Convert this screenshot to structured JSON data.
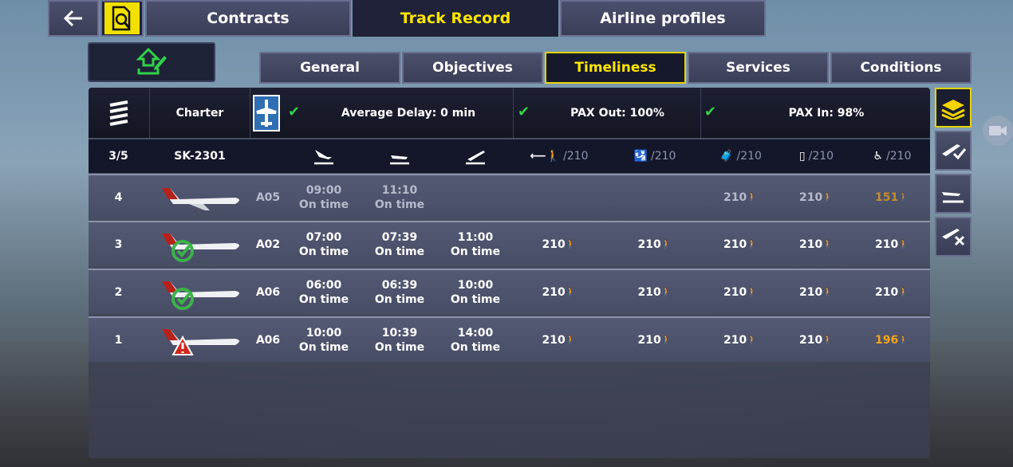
{
  "topnav": {
    "tabs": [
      "Contracts",
      "Track Record",
      "Airline profiles"
    ],
    "active": "Track Record"
  },
  "subtabs": {
    "items": [
      "General",
      "Objectives",
      "Timeliness",
      "Services",
      "Conditions"
    ],
    "active": "Timeliness"
  },
  "summary": {
    "type": "Charter",
    "avg_delay": "Average Delay: 0 min",
    "pax_out": "PAX Out: 100%",
    "pax_in": "PAX In: 98%"
  },
  "columns": {
    "index": "3/5",
    "flight": "SK-2301",
    "capacity": [
      "/210",
      "/210",
      "/210",
      "/210",
      "/210"
    ]
  },
  "rows": [
    {
      "num": "4",
      "stand": "A05",
      "arr": "09:00",
      "arr_s": "On time",
      "dep": "11:10",
      "dep_s": "On time",
      "to": "",
      "to_s": "",
      "p1": "",
      "p2": "",
      "p3": "210",
      "p4": "210",
      "p5": "151",
      "status": "pending"
    },
    {
      "num": "3",
      "stand": "A02",
      "arr": "07:00",
      "arr_s": "On time",
      "dep": "07:39",
      "dep_s": "On time",
      "to": "11:00",
      "to_s": "On time",
      "p1": "210",
      "p2": "210",
      "p3": "210",
      "p4": "210",
      "p5": "210",
      "status": "ok"
    },
    {
      "num": "2",
      "stand": "A06",
      "arr": "06:00",
      "arr_s": "On time",
      "dep": "06:39",
      "dep_s": "On time",
      "to": "10:00",
      "to_s": "On time",
      "p1": "210",
      "p2": "210",
      "p3": "210",
      "p4": "210",
      "p5": "210",
      "status": "ok"
    },
    {
      "num": "1",
      "stand": "A06",
      "arr": "10:00",
      "arr_s": "On time",
      "dep": "10:39",
      "dep_s": "On time",
      "to": "14:00",
      "to_s": "On time",
      "p1": "210",
      "p2": "210",
      "p3": "210",
      "p4": "210",
      "p5": "196",
      "status": "warning"
    }
  ],
  "colors": {
    "accent": "#ffe600",
    "ok": "#34d14a",
    "warn": "#f2a517",
    "alert": "#d0271c"
  },
  "icons": [
    "back-arrow-icon",
    "track-record-search-icon",
    "publish-icon",
    "airline-logo-icon",
    "charter-plane-icon",
    "arrival-icon",
    "landing-icon",
    "takeoff-icon",
    "pax-out-icon",
    "checkin-icon",
    "baggage-icon",
    "security-icon",
    "seat-icon",
    "all-flights-icon",
    "completed-flights-icon",
    "arriving-flights-icon",
    "cancelled-flights-icon",
    "camera-icon"
  ]
}
